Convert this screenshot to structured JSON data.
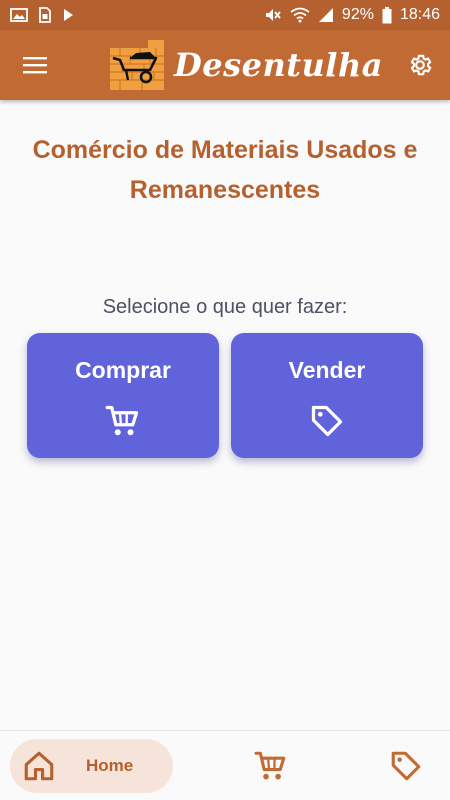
{
  "status_bar": {
    "battery_percent": "92%",
    "time": "18:46",
    "left_icons": [
      "image-icon",
      "sim-icon",
      "play-icon"
    ],
    "right_icons": [
      "mute-icon",
      "wifi-icon",
      "signal-icon",
      "battery-icon"
    ]
  },
  "app_bar": {
    "brand_name": "Desentulha",
    "menu_icon": "hamburger-menu-icon",
    "settings_icon": "gear-icon",
    "logo": "wheelbarrow-brick-logo"
  },
  "main": {
    "title": "Comércio de Materiais Usados e Remanescentes",
    "prompt": "Selecione o que quer fazer:",
    "actions": [
      {
        "label": "Comprar",
        "icon": "cart-icon"
      },
      {
        "label": "Vender",
        "icon": "tag-icon"
      }
    ]
  },
  "bottom_nav": {
    "items": [
      {
        "label": "Home",
        "icon": "home-icon",
        "active": true
      },
      {
        "label": "",
        "icon": "cart-icon",
        "active": false
      },
      {
        "label": "",
        "icon": "tag-icon",
        "active": false
      }
    ]
  },
  "colors": {
    "brand": "#c26a34",
    "status_bar": "#b4612f",
    "accent": "#6063d9",
    "active_nav_bg": "#f6e4da"
  }
}
